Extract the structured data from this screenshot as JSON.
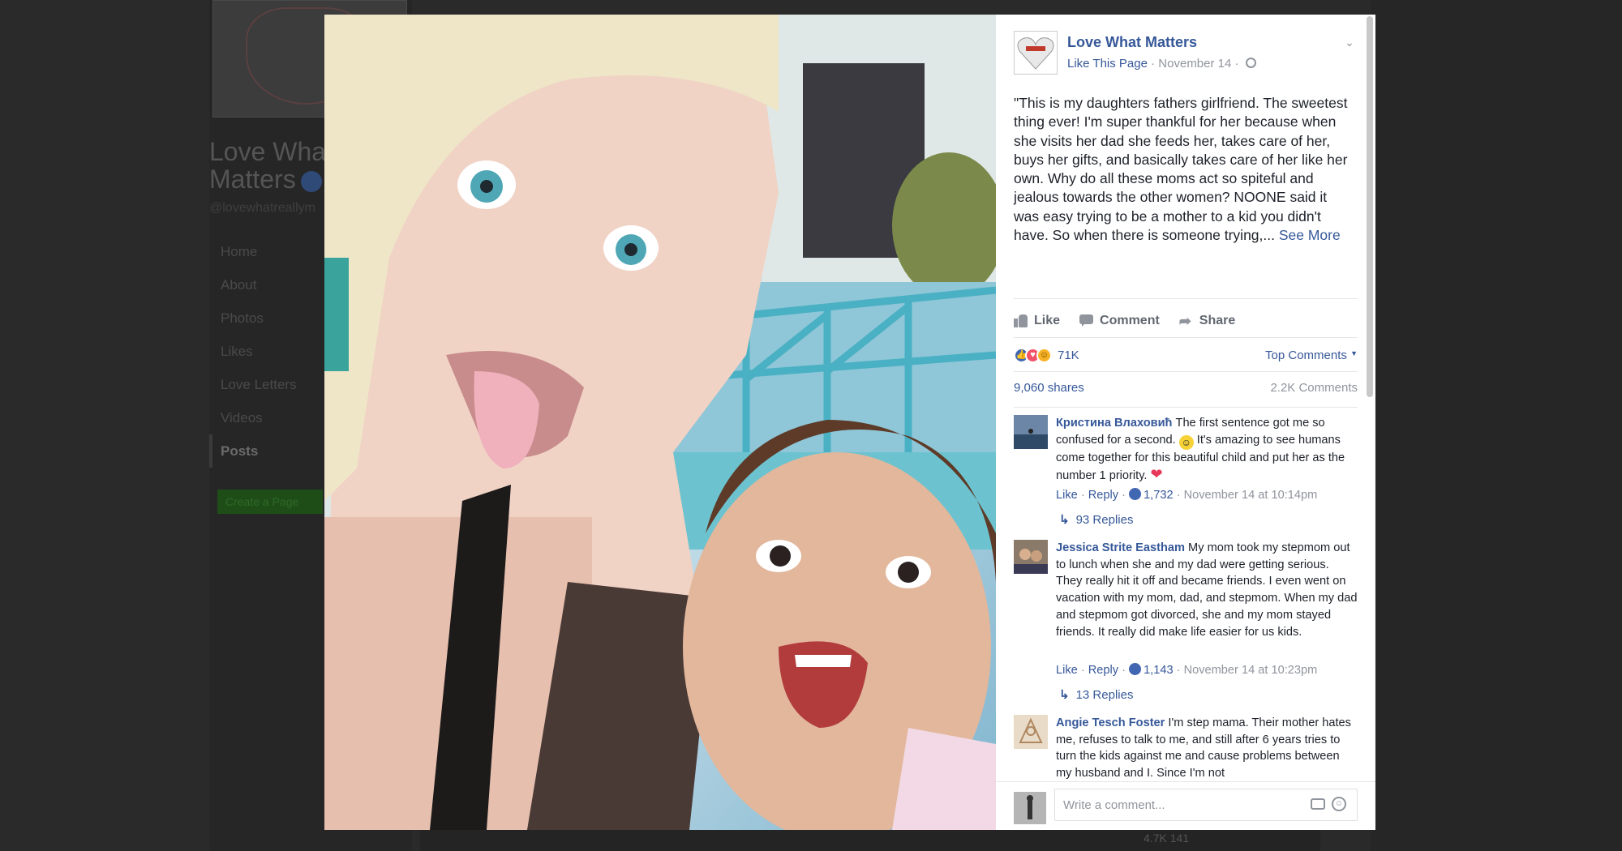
{
  "background": {
    "page_title_line1": "Love Wha",
    "page_title_line2": "Matters",
    "handle": "@lovewhatreallym",
    "nav": [
      "Home",
      "About",
      "Photos",
      "Likes",
      "Love Letters",
      "Videos",
      "Posts"
    ],
    "create_page": "Create a Page",
    "bottom_stats": "4.7K      141"
  },
  "post": {
    "page_name": "Love What Matters",
    "like_page": "Like This Page",
    "date": "November 14",
    "text": "\"This is my daughters fathers girlfriend. The sweetest thing ever! I'm super thankful for her because when she visits her dad she feeds her, takes care of her, buys her gifts, and basically takes care of her like her own. Why do all these moms act so spiteful and jealous towards the other women? NOONE said it was easy trying to be a mother to a kid you didn't have. So when there is someone trying,... ",
    "see_more": "See More"
  },
  "actions": {
    "like": "Like",
    "comment": "Comment",
    "share": "Share"
  },
  "stats": {
    "reactions_count": "71K",
    "top_comments": "Top Comments",
    "shares": "9,060 shares",
    "comments": "2.2K Comments"
  },
  "comments": [
    {
      "name": "Кристина Влаховић",
      "text_before_emoji": " The first sentence got me so confused for a second. ",
      "text_after_emoji": " It's amazing to see humans come together for this beautiful child and put her as the number 1 priority. ",
      "like": "Like",
      "reply": "Reply",
      "likes": "1,732",
      "time": "November 14 at 10:14pm",
      "replies": "93 Replies"
    },
    {
      "name": "Jessica Strite Eastham",
      "text": " My mom took my stepmom out to lunch when she and my dad were getting serious. They really hit it off and became friends. I even went on vacation with my mom, dad, and stepmom. When my dad and stepmom got divorced, she and my mom stayed friends. It really did make life easier for us kids.",
      "like": "Like",
      "reply": "Reply",
      "likes": "1,143",
      "time": "November 14 at 10:23pm",
      "replies": "13 Replies"
    },
    {
      "name": "Angie Tesch Foster",
      "text": " I'm step mama. Their mother hates me, refuses to talk to me, and still after 6 years tries to turn the kids against me and cause problems between my husband and I. Since I'm not"
    }
  ],
  "composer": {
    "placeholder": "Write a comment..."
  },
  "icons": {
    "globe": "globe-icon",
    "chevron": "chevron-down-icon",
    "like": "thumbs-up-icon",
    "comment": "comment-icon",
    "share": "share-arrow-icon",
    "reply_arrow": "reply-arrow-icon",
    "camera": "camera-icon",
    "emoji": "emoji-icon"
  },
  "colors": {
    "link": "#365899",
    "muted": "#90949c",
    "text": "#1d2129",
    "like_blue": "#4267b2",
    "love_red": "#f25268",
    "haha_yellow": "#f7b125"
  }
}
